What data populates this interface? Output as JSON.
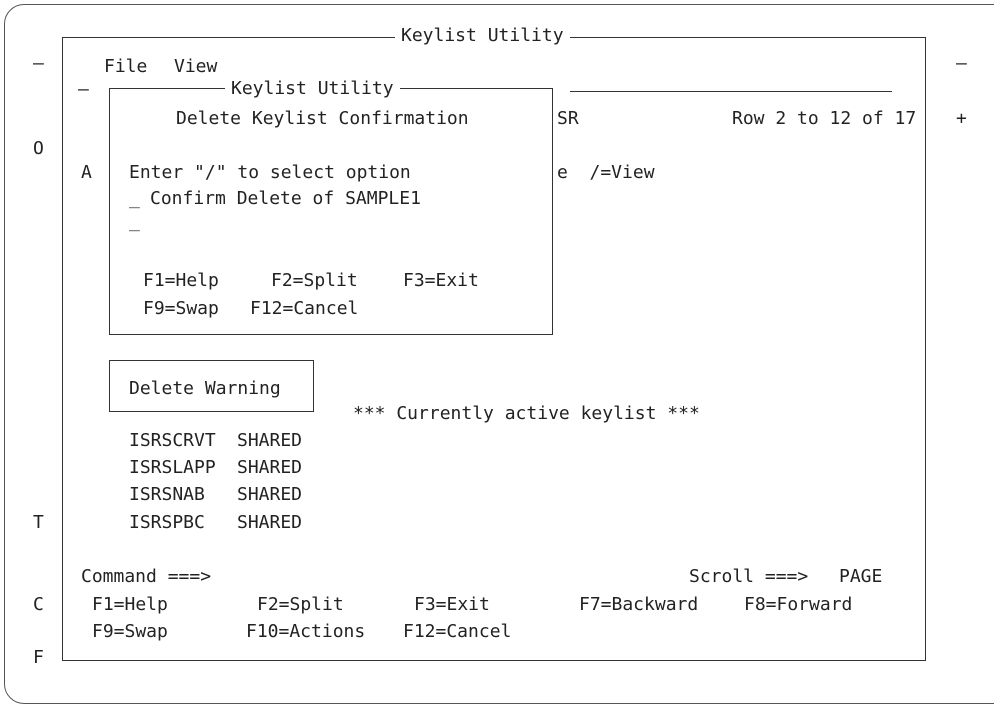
{
  "outer": {
    "markers": {
      "row1": "—",
      "row2": "O",
      "row3": "T",
      "row4": "C",
      "row5": "F",
      "right1": "—",
      "right2": "+"
    }
  },
  "main_window": {
    "title": "Keylist Utility",
    "menu": [
      "File",
      "View"
    ],
    "dash_marker": "—",
    "a_marker": "A",
    "right_frag1": "SR",
    "row_info": "Row 2 to 12 of 17",
    "right_frag2": "e  /=View",
    "active_message": "*** Currently active keylist ***",
    "keylists": [
      {
        "name": "ISRSCRVT",
        "type": "SHARED"
      },
      {
        "name": "ISRSLAPP",
        "type": "SHARED"
      },
      {
        "name": "ISRSNAB",
        "type": "SHARED"
      },
      {
        "name": "ISRSPBC",
        "type": "SHARED"
      }
    ],
    "command_label": "Command ===>",
    "command_value": "",
    "scroll_label": "Scroll ===>",
    "scroll_value": "PAGE",
    "fkeys_row1": [
      "F1=Help",
      "F2=Split",
      "F3=Exit",
      "F7=Backward",
      "F8=Forward"
    ],
    "fkeys_row2": [
      "F9=Swap",
      "F10=Actions",
      "F12=Cancel"
    ]
  },
  "popup": {
    "title": "Keylist Utility",
    "heading": "Delete Keylist Confirmation",
    "instruction": "Enter \"/\" to select option",
    "option_label": "Confirm Delete of SAMPLE1",
    "option_value": "_",
    "field_cursor": "_",
    "fkeys_row1": [
      "F1=Help",
      "F2=Split",
      "F3=Exit"
    ],
    "fkeys_row2": [
      "F9=Swap",
      "F12=Cancel"
    ]
  },
  "warning": {
    "label": "Delete Warning"
  }
}
